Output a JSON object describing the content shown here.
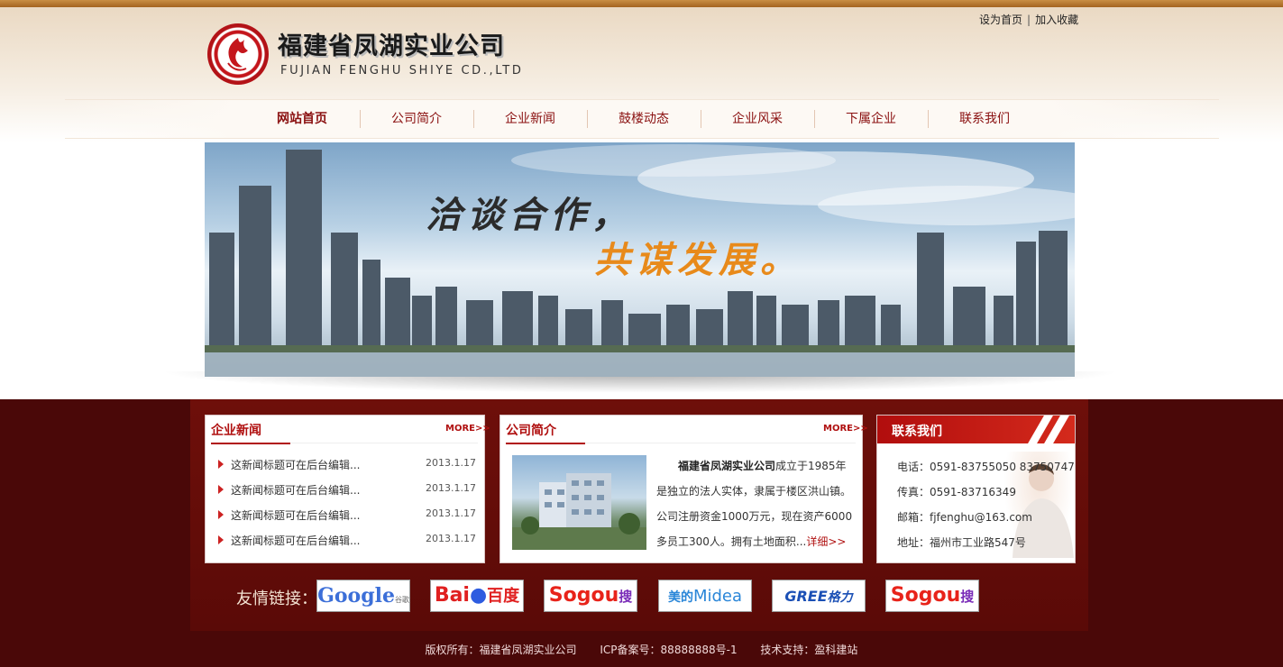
{
  "toplinks": {
    "set_home": "设为首页",
    "separator": "|",
    "favorite": "加入收藏"
  },
  "brand": {
    "name_cn": "福建省凤湖实业公司",
    "name_en": "FUJIAN FENGHU SHIYE CD.,LTD"
  },
  "nav": {
    "items": [
      "网站首页",
      "公司简介",
      "企业新闻",
      "鼓楼动态",
      "企业风采",
      "下属企业",
      "联系我们"
    ]
  },
  "banner": {
    "line1": "洽谈合作，",
    "line2": "共谋发展。"
  },
  "news": {
    "title": "企业新闻",
    "more": "MORE>>",
    "items": [
      {
        "title": "这新闻标题可在后台编辑...",
        "date": "2013.1.17"
      },
      {
        "title": "这新闻标题可在后台编辑...",
        "date": "2013.1.17"
      },
      {
        "title": "这新闻标题可在后台编辑...",
        "date": "2013.1.17"
      },
      {
        "title": "这新闻标题可在后台编辑...",
        "date": "2013.1.17"
      }
    ]
  },
  "about": {
    "title": "公司简介",
    "more": "MORE>>",
    "company": "福建省凤湖实业公司",
    "text": "成立于1985年是独立的法人实体，隶属于楼区洪山镇。公司注册资金1000万元，现在资产6000多员工300人。拥有土地面积...",
    "detail": "详细>>"
  },
  "contact": {
    "title": "联系我们",
    "phone": "电话：0591-83755050 83750747",
    "fax": "传真：0591-83716349",
    "email": "邮箱：fjfenghu@163.com",
    "address": "地址：福州市工业路547号"
  },
  "links": {
    "label": "友情链接：",
    "items": [
      {
        "text": "Google",
        "sub": "谷歌"
      },
      {
        "text": "Bai",
        "sub": "百度"
      },
      {
        "text": "Sogou",
        "sub": "搜狗"
      },
      {
        "text": "美的",
        "sub": "Midea"
      },
      {
        "text": "GREE",
        "sub": "格力"
      },
      {
        "text": "Sogou",
        "sub": "搜狗"
      }
    ]
  },
  "footer": {
    "copyright": "版权所有：福建省凤湖实业公司",
    "icp": "ICP备案号：88888888号-1",
    "support": "技术支持：盈科建站"
  },
  "colors": {
    "maroon": "#4a0808",
    "accent_red": "#b01010",
    "slogan_orange": "#e88a1b"
  }
}
